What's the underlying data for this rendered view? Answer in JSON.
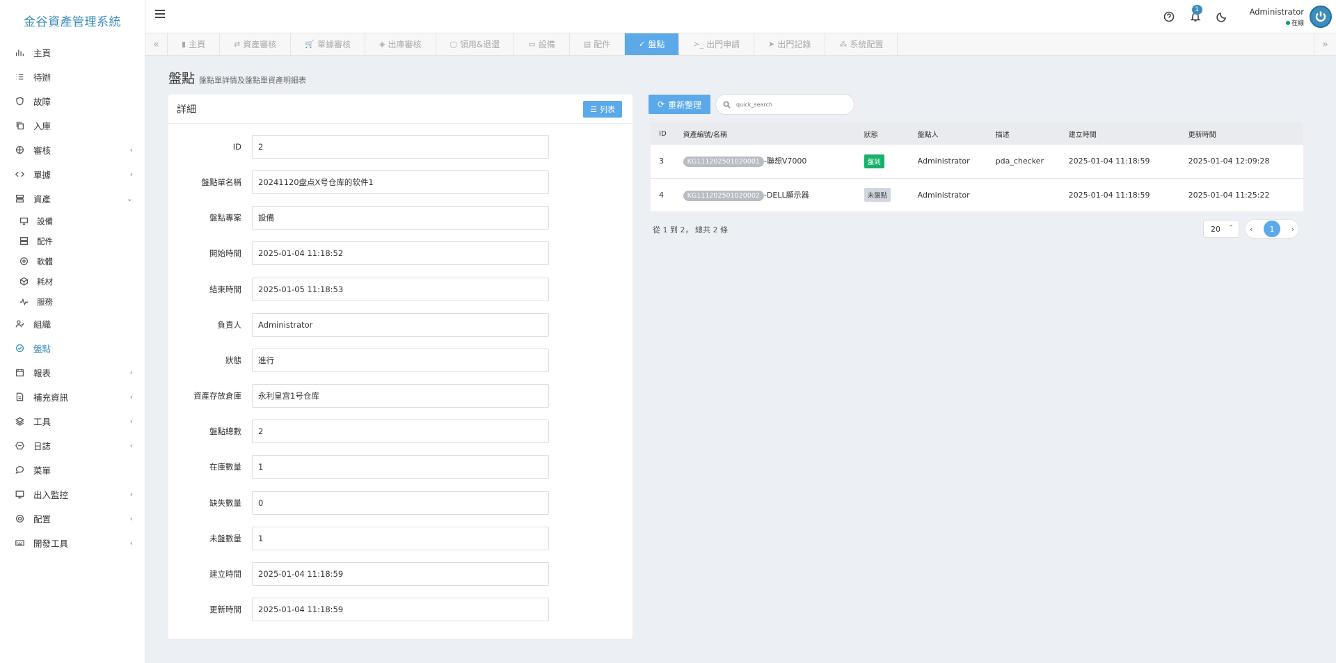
{
  "app": {
    "title": "金谷資產管理系統"
  },
  "sidebar": {
    "items": [
      {
        "label": "主頁",
        "icon": "bar-chart-icon"
      },
      {
        "label": "待辦",
        "icon": "list-icon"
      },
      {
        "label": "故障",
        "icon": "shield-icon"
      },
      {
        "label": "入庫",
        "icon": "copy-icon"
      },
      {
        "label": "審核",
        "icon": "audit-icon",
        "arrow": "‹"
      },
      {
        "label": "單據",
        "icon": "code-icon",
        "arrow": "‹"
      },
      {
        "label": "資產",
        "icon": "server-icon",
        "arrow": "⌄"
      }
    ],
    "asset_sub": [
      {
        "label": "設備",
        "icon": "monitor-icon"
      },
      {
        "label": "配件",
        "icon": "hdd-icon"
      },
      {
        "label": "軟體",
        "icon": "disc-icon"
      },
      {
        "label": "耗材",
        "icon": "cube-icon"
      },
      {
        "label": "服務",
        "icon": "pulse-icon"
      }
    ],
    "items2": [
      {
        "label": "組織",
        "icon": "users-icon"
      },
      {
        "label": "盤點",
        "icon": "check-circle-icon",
        "active": true
      },
      {
        "label": "報表",
        "icon": "calendar-icon",
        "arrow": "‹"
      },
      {
        "label": "補充資訊",
        "icon": "file-icon",
        "arrow": "‹"
      },
      {
        "label": "工具",
        "icon": "layers-icon",
        "arrow": "‹"
      },
      {
        "label": "日誌",
        "icon": "hexagon-icon",
        "arrow": "‹"
      },
      {
        "label": "菜單",
        "icon": "comment-icon"
      },
      {
        "label": "出入監控",
        "icon": "desktop-icon",
        "arrow": "‹"
      },
      {
        "label": "配置",
        "icon": "gear-icon",
        "arrow": "‹"
      },
      {
        "label": "開發工具",
        "icon": "keyboard-icon",
        "arrow": "‹"
      }
    ]
  },
  "header": {
    "notification_count": "1",
    "user_name": "Administrator",
    "user_status": "在線"
  },
  "tabs": [
    {
      "label": "主頁",
      "icon": "▮"
    },
    {
      "label": "資產審核",
      "icon": "⇄"
    },
    {
      "label": "單據審核",
      "icon": "🛒"
    },
    {
      "label": "出庫審核",
      "icon": "◈"
    },
    {
      "label": "領用&退還",
      "icon": "▢"
    },
    {
      "label": "設備",
      "icon": "▭"
    },
    {
      "label": "配件",
      "icon": "▤"
    },
    {
      "label": "盤點",
      "icon": "✓",
      "active": true
    },
    {
      "label": "出門申請",
      "icon": ">_"
    },
    {
      "label": "出門記錄",
      "icon": "➤"
    },
    {
      "label": "系統配置",
      "icon": "⁂"
    }
  ],
  "page": {
    "title": "盤點",
    "subtitle": "盤點單詳情及盤點單資產明細表"
  },
  "detail": {
    "panel_title": "詳細",
    "list_button": "列表",
    "fields": [
      {
        "label": "ID",
        "value": "2"
      },
      {
        "label": "盤點單名稱",
        "value": "20241120盘点X号仓库的软件1"
      },
      {
        "label": "盤點專案",
        "value": "設備"
      },
      {
        "label": "開始時間",
        "value": "2025-01-04 11:18:52"
      },
      {
        "label": "結束時間",
        "value": "2025-01-05 11:18:53"
      },
      {
        "label": "負責人",
        "value": "Administrator"
      },
      {
        "label": "狀態",
        "value": "進行"
      },
      {
        "label": "資產存放倉庫",
        "value": "永利皇宫1号仓库"
      },
      {
        "label": "盤點總數",
        "value": "2"
      },
      {
        "label": "在庫數量",
        "value": "1"
      },
      {
        "label": "缺失數量",
        "value": "0"
      },
      {
        "label": "未盤數量",
        "value": "1"
      },
      {
        "label": "建立時間",
        "value": "2025-01-04 11:18:59"
      },
      {
        "label": "更新時間",
        "value": "2025-01-04 11:18:59"
      }
    ]
  },
  "toolbar": {
    "refresh_label": "重新整理",
    "search_placeholder": "quick_search"
  },
  "table": {
    "headers": [
      "ID",
      "資產編號/名稱",
      "狀態",
      "盤點人",
      "描述",
      "建立時間",
      "更新時間"
    ],
    "rows": [
      {
        "id": "3",
        "code": "KG111202501020001",
        "name": "-聯想V7000",
        "status": "盤到",
        "status_type": "green",
        "checker": "Administrator",
        "desc": "pda_checker",
        "created": "2025-01-04 11:18:59",
        "updated": "2025-01-04 12:09:28"
      },
      {
        "id": "4",
        "code": "KG111202501020002",
        "name": "-DELL顯示器",
        "status": "未盤點",
        "status_type": "gray",
        "checker": "Administrator",
        "desc": "",
        "created": "2025-01-04 11:18:59",
        "updated": "2025-01-04 11:25:22"
      }
    ]
  },
  "pagination": {
    "summary": "從 1 到 2， 總共 2 條",
    "page_size": "20",
    "current_page": "1"
  },
  "colors": {
    "accent": "#5ba9e9",
    "brand": "#3c8dbc",
    "success": "#18b06a"
  }
}
